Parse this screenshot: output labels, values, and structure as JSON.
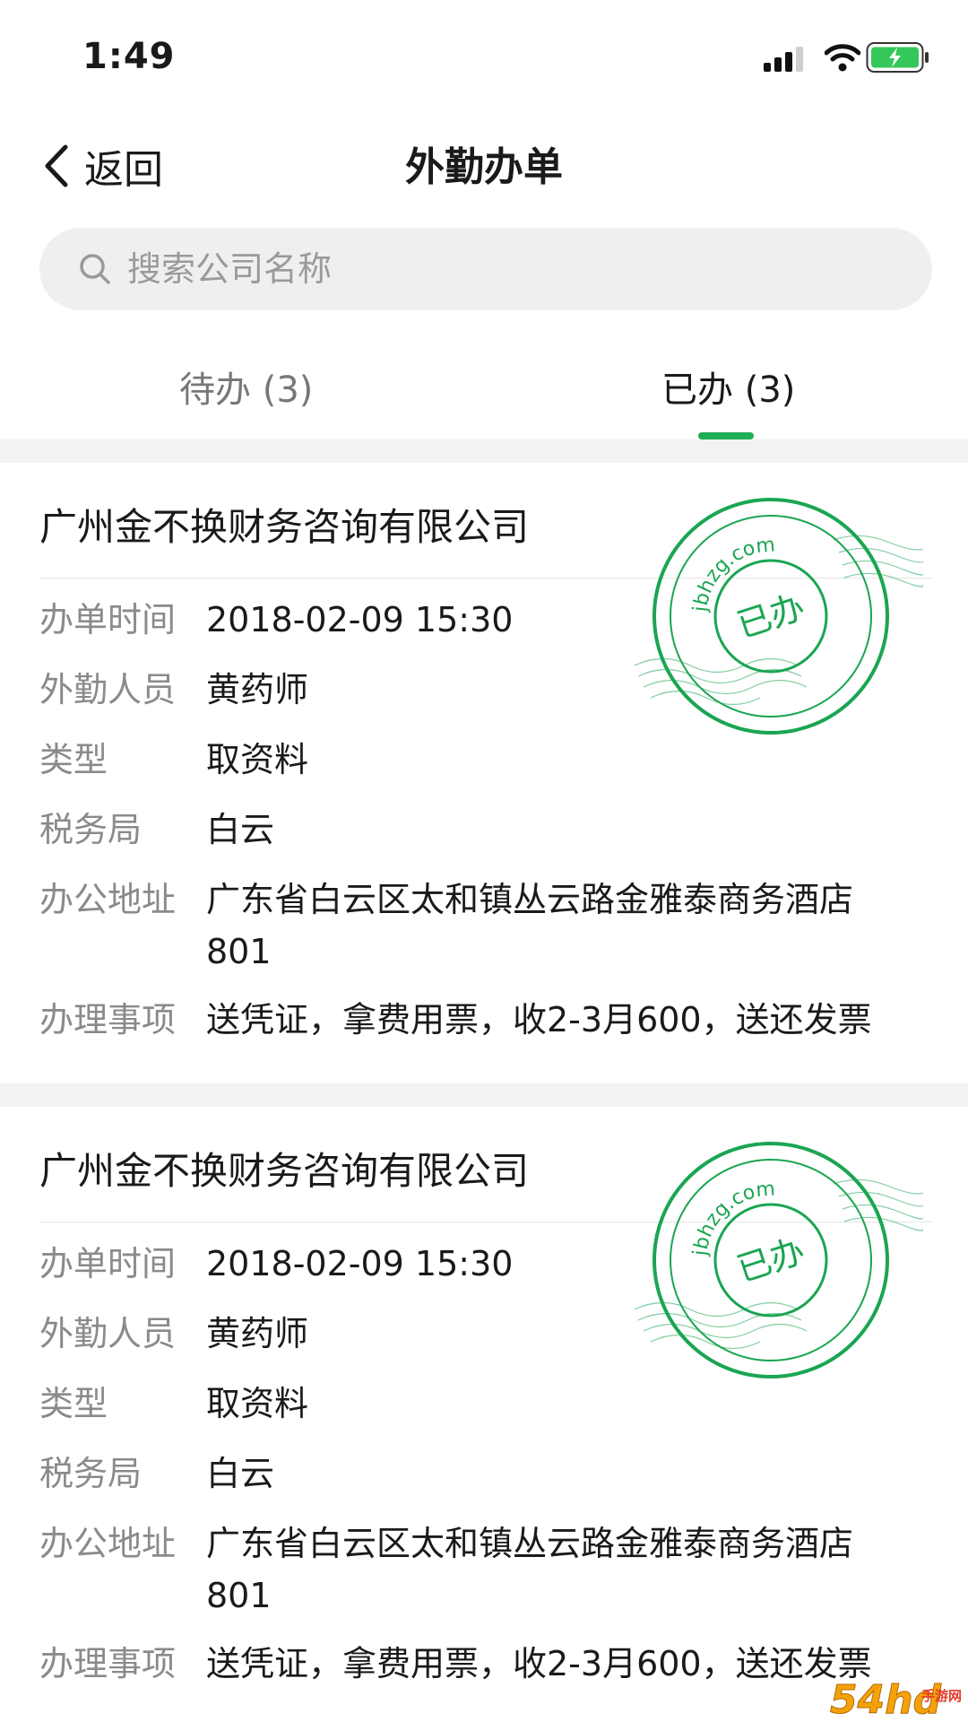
{
  "status": {
    "time": "1:49"
  },
  "nav": {
    "back_label": "返回",
    "title": "外勤办单"
  },
  "search": {
    "placeholder": "搜索公司名称"
  },
  "tabs": [
    {
      "label": "待办 (3)",
      "active": false
    },
    {
      "label": "已办 (3)",
      "active": true
    }
  ],
  "labels": {
    "time": "办单时间",
    "staff": "外勤人员",
    "type": "类型",
    "bureau": "税务局",
    "address": "办公地址",
    "items": "办理事项"
  },
  "stamp": {
    "text": "已办",
    "url": "jbhzg.com"
  },
  "cards": [
    {
      "company": "广州金不换财务咨询有限公司",
      "time": "2018-02-09  15:30",
      "staff": "黄药师",
      "type": "取资料",
      "bureau": "白云",
      "address": "广东省白云区太和镇丛云路金雅泰商务酒店801",
      "items": "送凭证，拿费用票，收2-3月600，送还发票"
    },
    {
      "company": "广州金不换财务咨询有限公司",
      "time": "2018-02-09  15:30",
      "staff": "黄药师",
      "type": "取资料",
      "bureau": "白云",
      "address": "广东省白云区太和镇丛云路金雅泰商务酒店801",
      "items": "送凭证，拿费用票，收2-3月600，送还发票"
    }
  ],
  "watermark": {
    "brand": "54hd",
    "site": "手游网"
  },
  "colors": {
    "accent": "#1fae56",
    "stamp": "#1aa552"
  }
}
